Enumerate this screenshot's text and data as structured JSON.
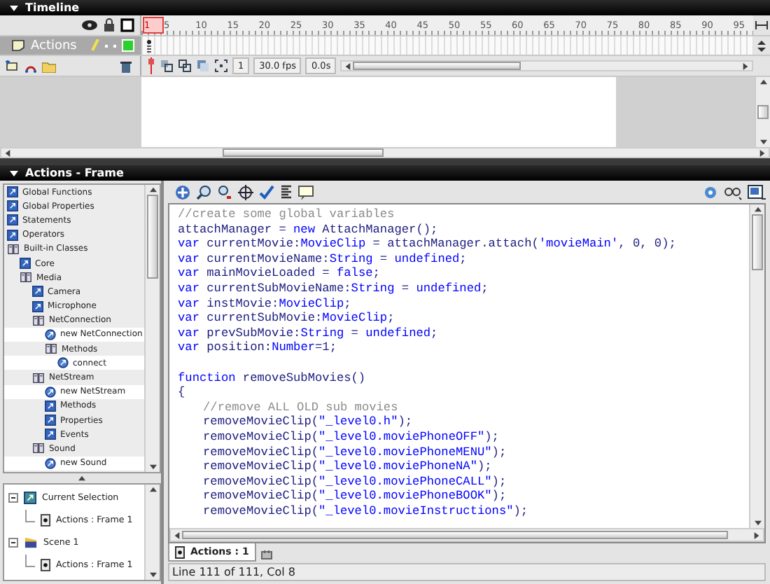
{
  "timeline": {
    "title": "Timeline",
    "ruler": [
      "1",
      "5",
      "10",
      "15",
      "20",
      "25",
      "30",
      "35",
      "40",
      "45",
      "50",
      "55",
      "60",
      "65",
      "70",
      "75",
      "80",
      "85",
      "90",
      "95"
    ],
    "layers": [
      {
        "name": "Actions",
        "selected": true
      }
    ],
    "current_frame": "1",
    "frame_rate": "30.0 fps",
    "elapsed": "0.0s"
  },
  "actions_panel": {
    "title": "Actions - Frame",
    "toolbox": [
      {
        "label": "Global Functions",
        "kind": "category",
        "expanded": false
      },
      {
        "label": "Global Properties",
        "kind": "category",
        "expanded": false
      },
      {
        "label": "Statements",
        "kind": "category",
        "expanded": false
      },
      {
        "label": "Operators",
        "kind": "category",
        "expanded": false
      },
      {
        "label": "Built-in Classes",
        "kind": "category",
        "expanded": true,
        "children": [
          {
            "label": "Core",
            "kind": "category",
            "expanded": false
          },
          {
            "label": "Media",
            "kind": "category",
            "expanded": true,
            "children": [
              {
                "label": "Camera",
                "kind": "category",
                "expanded": false
              },
              {
                "label": "Microphone",
                "kind": "category",
                "expanded": false
              },
              {
                "label": "NetConnection",
                "kind": "category",
                "expanded": true,
                "children": [
                  {
                    "label": "new NetConnection",
                    "kind": "method"
                  },
                  {
                    "label": "Methods",
                    "kind": "category",
                    "expanded": true,
                    "children": [
                      {
                        "label": "connect",
                        "kind": "method"
                      }
                    ]
                  }
                ]
              },
              {
                "label": "NetStream",
                "kind": "category",
                "expanded": true,
                "children": [
                  {
                    "label": "new NetStream",
                    "kind": "method"
                  },
                  {
                    "label": "Methods",
                    "kind": "category",
                    "expanded": false
                  },
                  {
                    "label": "Properties",
                    "kind": "category",
                    "expanded": false
                  },
                  {
                    "label": "Events",
                    "kind": "category",
                    "expanded": false
                  }
                ]
              },
              {
                "label": "Sound",
                "kind": "category",
                "expanded": true,
                "children": [
                  {
                    "label": "new Sound",
                    "kind": "method"
                  }
                ]
              }
            ]
          }
        ]
      }
    ],
    "navigator": [
      {
        "label": "Current Selection",
        "kind": "selection",
        "expanded": true,
        "children": [
          {
            "label": "Actions : Frame 1",
            "kind": "frame"
          }
        ]
      },
      {
        "label": "Scene 1",
        "kind": "scene",
        "expanded": true,
        "children": [
          {
            "label": "Actions : Frame 1",
            "kind": "frame"
          }
        ]
      }
    ],
    "code": [
      {
        "segments": [
          {
            "kind": "comment",
            "text": "//create some global variables"
          }
        ]
      },
      {
        "segments": [
          {
            "kind": "plain",
            "text": "attachManager = "
          },
          {
            "kind": "keyword",
            "text": "new"
          },
          {
            "kind": "plain",
            "text": " AttachManager();"
          }
        ]
      },
      {
        "segments": [
          {
            "kind": "keyword",
            "text": "var"
          },
          {
            "kind": "plain",
            "text": " currentMovie:"
          },
          {
            "kind": "keyword",
            "text": "MovieClip"
          },
          {
            "kind": "plain",
            "text": " = attachManager.attach("
          },
          {
            "kind": "string",
            "text": "'movieMain'"
          },
          {
            "kind": "plain",
            "text": ", 0, 0);"
          }
        ]
      },
      {
        "segments": [
          {
            "kind": "keyword",
            "text": "var"
          },
          {
            "kind": "plain",
            "text": " currentMovieName:"
          },
          {
            "kind": "keyword",
            "text": "String"
          },
          {
            "kind": "plain",
            "text": " = "
          },
          {
            "kind": "keyword",
            "text": "undefined"
          },
          {
            "kind": "plain",
            "text": ";"
          }
        ]
      },
      {
        "segments": [
          {
            "kind": "keyword",
            "text": "var"
          },
          {
            "kind": "plain",
            "text": " mainMovieLoaded = "
          },
          {
            "kind": "keyword",
            "text": "false"
          },
          {
            "kind": "plain",
            "text": ";"
          }
        ]
      },
      {
        "segments": [
          {
            "kind": "keyword",
            "text": "var"
          },
          {
            "kind": "plain",
            "text": " currentSubMovieName:"
          },
          {
            "kind": "keyword",
            "text": "String"
          },
          {
            "kind": "plain",
            "text": " = "
          },
          {
            "kind": "keyword",
            "text": "undefined"
          },
          {
            "kind": "plain",
            "text": ";"
          }
        ]
      },
      {
        "segments": [
          {
            "kind": "keyword",
            "text": "var"
          },
          {
            "kind": "plain",
            "text": " instMovie:"
          },
          {
            "kind": "keyword",
            "text": "MovieClip"
          },
          {
            "kind": "plain",
            "text": ";"
          }
        ]
      },
      {
        "segments": [
          {
            "kind": "keyword",
            "text": "var"
          },
          {
            "kind": "plain",
            "text": " currentSubMovie:"
          },
          {
            "kind": "keyword",
            "text": "MovieClip"
          },
          {
            "kind": "plain",
            "text": ";"
          }
        ]
      },
      {
        "segments": [
          {
            "kind": "keyword",
            "text": "var"
          },
          {
            "kind": "plain",
            "text": " prevSubMovie:"
          },
          {
            "kind": "keyword",
            "text": "String"
          },
          {
            "kind": "plain",
            "text": " = "
          },
          {
            "kind": "keyword",
            "text": "undefined"
          },
          {
            "kind": "plain",
            "text": ";"
          }
        ]
      },
      {
        "segments": [
          {
            "kind": "keyword",
            "text": "var"
          },
          {
            "kind": "plain",
            "text": " position:"
          },
          {
            "kind": "keyword",
            "text": "Number"
          },
          {
            "kind": "plain",
            "text": "=1;"
          }
        ]
      },
      {
        "space_before": true,
        "segments": [
          {
            "kind": "keyword",
            "text": "function"
          },
          {
            "kind": "plain",
            "text": " removeSubMovies()"
          }
        ]
      },
      {
        "segments": [
          {
            "kind": "plain",
            "text": "{"
          }
        ]
      },
      {
        "indented": true,
        "segments": [
          {
            "kind": "comment",
            "text": "//remove ALL OLD sub movies"
          }
        ]
      },
      {
        "indented": true,
        "segments": [
          {
            "kind": "plain",
            "text": "removeMovieClip("
          },
          {
            "kind": "string",
            "text": "\"_level0.h\""
          },
          {
            "kind": "plain",
            "text": ");"
          }
        ]
      },
      {
        "indented": true,
        "segments": [
          {
            "kind": "plain",
            "text": "removeMovieClip("
          },
          {
            "kind": "string",
            "text": "\"_level0.moviePhoneOFF\""
          },
          {
            "kind": "plain",
            "text": ");"
          }
        ]
      },
      {
        "indented": true,
        "segments": [
          {
            "kind": "plain",
            "text": "removeMovieClip("
          },
          {
            "kind": "string",
            "text": "\"_level0.moviePhoneMENU\""
          },
          {
            "kind": "plain",
            "text": ");"
          }
        ]
      },
      {
        "indented": true,
        "segments": [
          {
            "kind": "plain",
            "text": "removeMovieClip("
          },
          {
            "kind": "string",
            "text": "\"_level0.moviePhoneNA\""
          },
          {
            "kind": "plain",
            "text": ");"
          }
        ]
      },
      {
        "indented": true,
        "segments": [
          {
            "kind": "plain",
            "text": "removeMovieClip("
          },
          {
            "kind": "string",
            "text": "\"_level0.moviePhoneCALL\""
          },
          {
            "kind": "plain",
            "text": ");"
          }
        ]
      },
      {
        "indented": true,
        "segments": [
          {
            "kind": "plain",
            "text": "removeMovieClip("
          },
          {
            "kind": "string",
            "text": "\"_level0.moviePhoneBOOK\""
          },
          {
            "kind": "plain",
            "text": ");"
          }
        ]
      },
      {
        "indented": true,
        "segments": [
          {
            "kind": "plain",
            "text": "removeMovieClip("
          },
          {
            "kind": "string",
            "text": "\"_level0.movieInstructions\""
          },
          {
            "kind": "plain",
            "text": ");"
          }
        ]
      }
    ],
    "script_tabs": [
      {
        "label": "Actions : 1",
        "selected": true
      }
    ],
    "status_bar": "Line 111 of 111, Col 8"
  }
}
